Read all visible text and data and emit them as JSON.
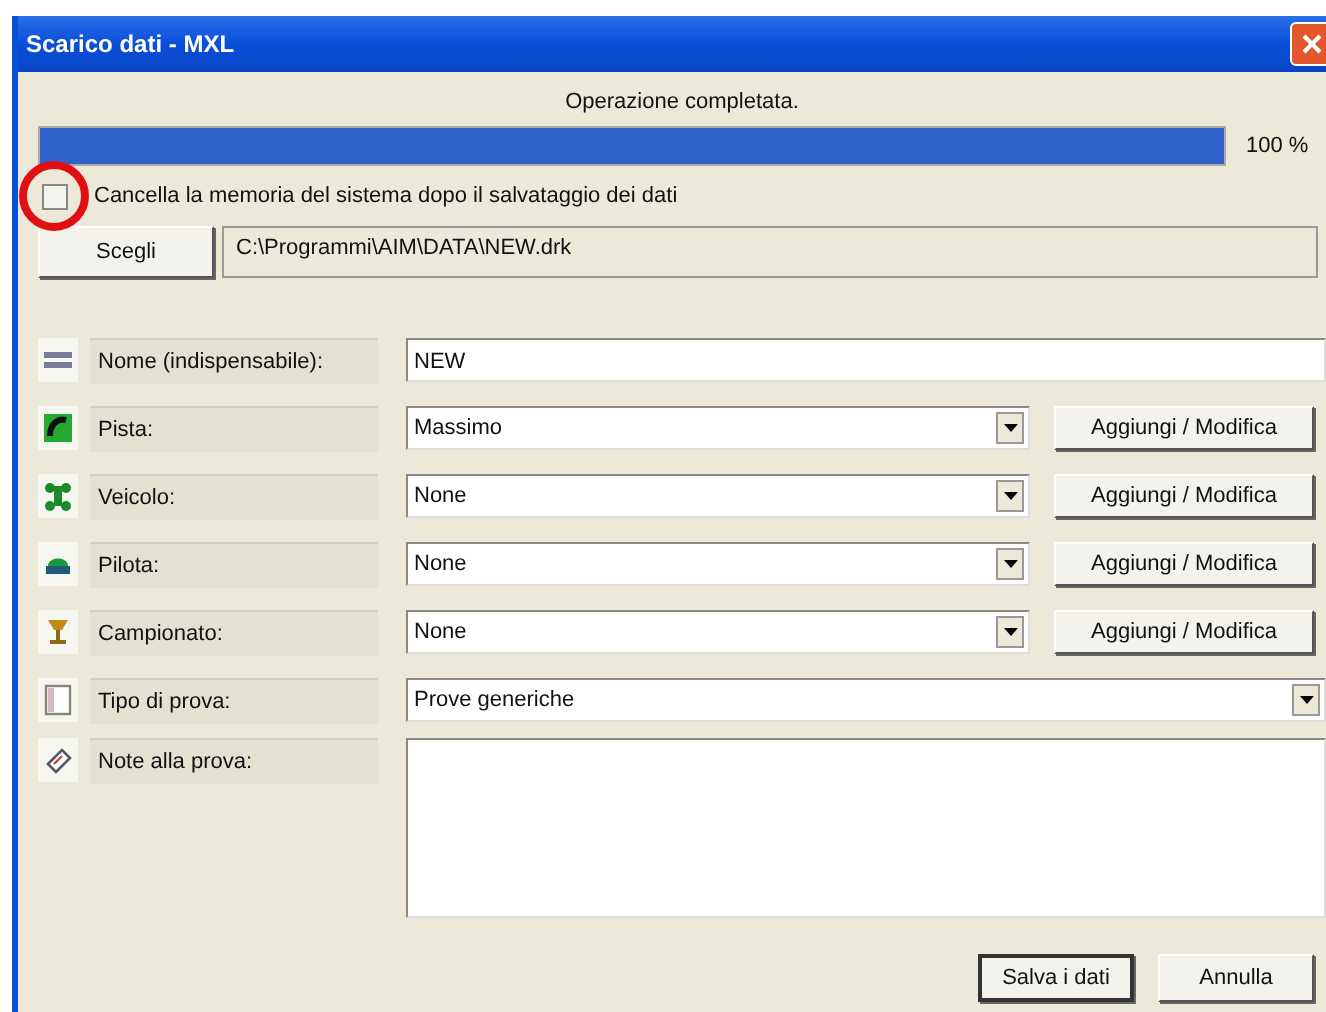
{
  "window": {
    "title": "Scarico dati - MXL"
  },
  "status": "Operazione completata.",
  "progress": {
    "level": 1.0,
    "reading": "100 %"
  },
  "erase_option": {
    "label": "Cancella la memoria del sistema dopo il salvataggio dei dati",
    "checked": false
  },
  "file": {
    "button": "Scegli",
    "path": "C:\\Programmi\\AIM\\DATA\\NEW.drk"
  },
  "fields": [
    {
      "kind": "text",
      "label": "Nome (indispensabile):",
      "value": "NEW"
    },
    {
      "kind": "select_edit",
      "label": "Pista:",
      "value": "Massimo",
      "button": "Aggiungi / Modifica"
    },
    {
      "kind": "select_edit",
      "label": "Veicolo:",
      "value": "None",
      "button": "Aggiungi / Modifica"
    },
    {
      "kind": "select_edit",
      "label": "Pilota:",
      "value": "None",
      "button": "Aggiungi / Modifica"
    },
    {
      "kind": "select_edit",
      "label": "Campionato:",
      "value": "None",
      "button": "Aggiungi / Modifica"
    },
    {
      "kind": "select",
      "label": "Tipo di prova:",
      "value": "Prove generiche"
    },
    {
      "kind": "textarea",
      "label": "Note alla prova:"
    }
  ],
  "buttons": [
    "Salva i dati",
    "Annulla"
  ]
}
